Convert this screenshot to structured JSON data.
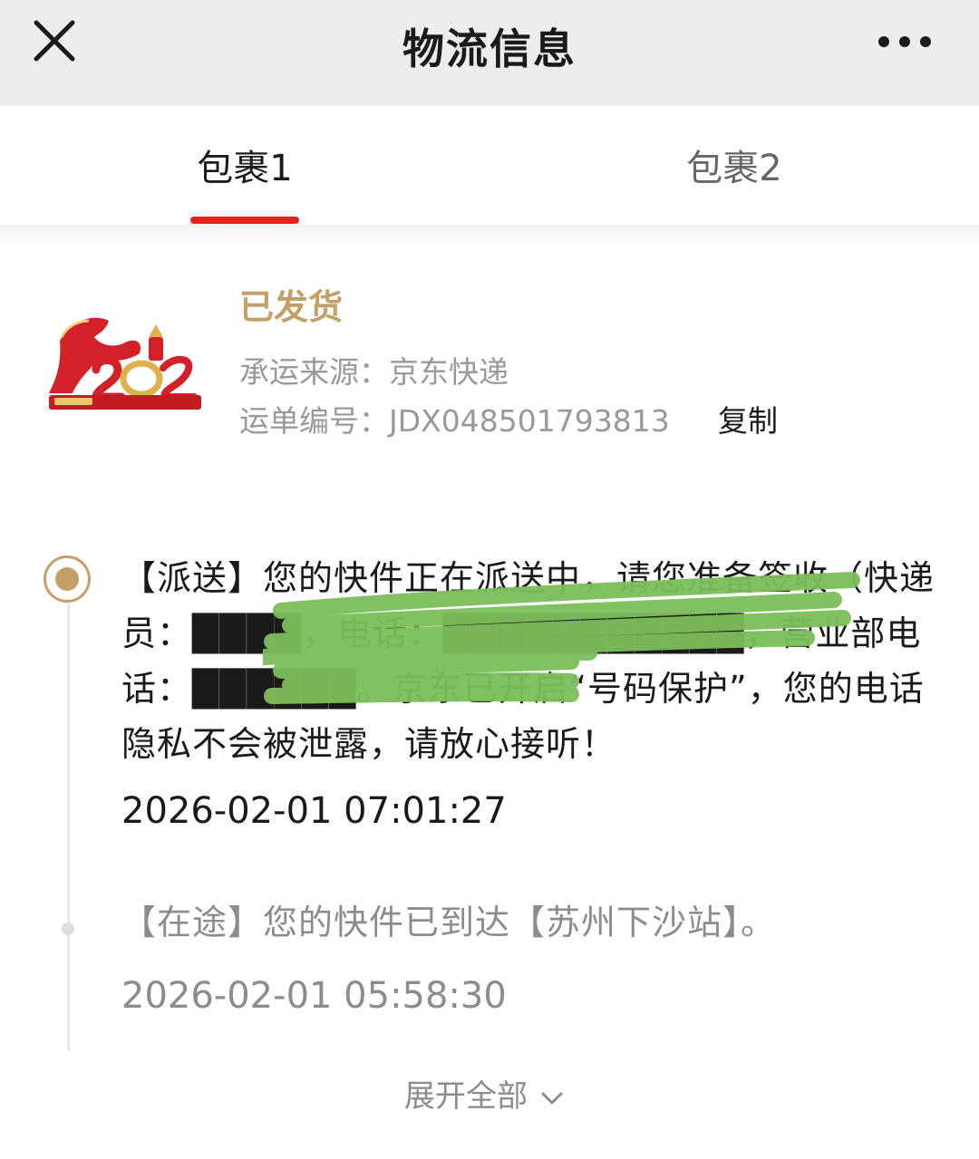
{
  "header": {
    "title": "物流信息"
  },
  "tabs": [
    {
      "label": "包裹1",
      "active": true
    },
    {
      "label": "包裹2",
      "active": false
    }
  ],
  "package": {
    "status": "已发货",
    "carrier_line": "承运来源：京东快递",
    "waybill_line": "运单编号：JDX048501793813",
    "copy_label": "复制"
  },
  "timeline": [
    {
      "text": "【派送】您的快件正在派送中，请您准备签收（快递员：████，电话：███████████，营业部电话：██████。京东已开启“号码保护”，您的电话隐私不会被泄露，请放心接听！",
      "time": "2026-02-01 07:01:27"
    },
    {
      "text": "【在途】您的快件已到达【苏州下沙站】。",
      "time": "2026-02-01 05:58:30"
    }
  ],
  "expand_label": "展开全部",
  "colors": {
    "accent_red": "#e2231a",
    "gold": "#c4a067",
    "header_bg": "#ededed"
  },
  "icons": {
    "close": "close-icon",
    "more": "more-dots-icon",
    "expand": "chevron-down-icon"
  }
}
